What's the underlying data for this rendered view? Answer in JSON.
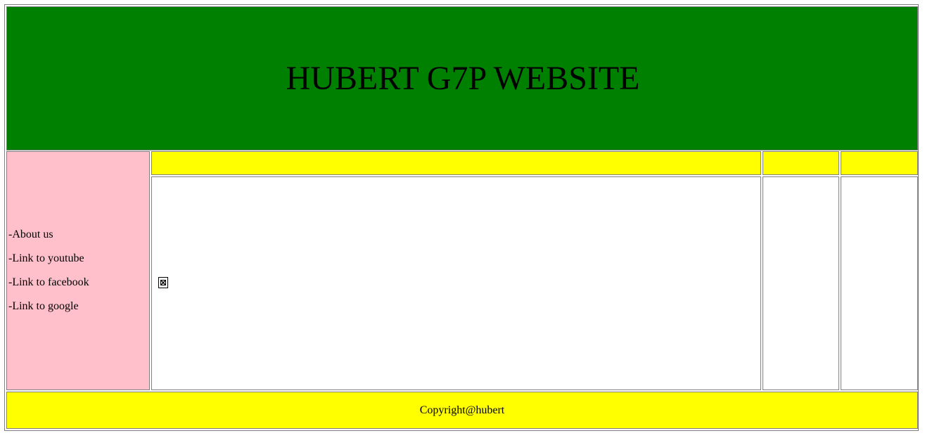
{
  "header": {
    "title": "HUBERT G7P WEBSITE"
  },
  "sidebar": {
    "items": [
      {
        "label": "-About us"
      },
      {
        "label": "-Link to youtube"
      },
      {
        "label": "-Link to facebook"
      },
      {
        "label": "-Link to google"
      }
    ]
  },
  "main": {
    "image_icon": "broken-image-icon"
  },
  "footer": {
    "text": "Copyright@hubert"
  },
  "colors": {
    "header_bg": "#008000",
    "sidebar_bg": "#ffc0cb",
    "bar_bg": "#ffff00",
    "content_bg": "#ffffff",
    "border": "#808080"
  }
}
